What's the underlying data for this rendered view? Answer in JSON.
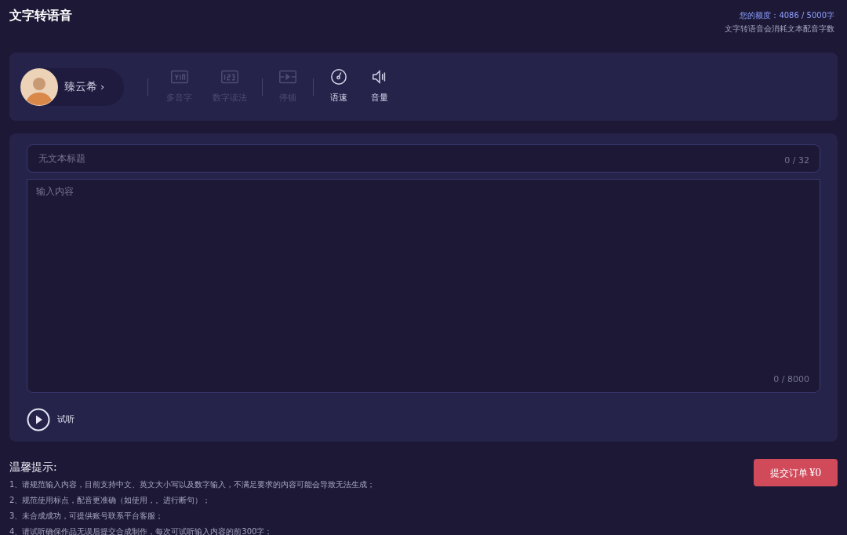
{
  "header": {
    "title": "文字转语音",
    "quota": "您的额度：4086 / 5000字",
    "quota_note": "文字转语音会消耗文本配音字数"
  },
  "voice": {
    "name": "臻云希",
    "arrow": "›"
  },
  "tools": [
    {
      "kind": "yin",
      "label": "多音字",
      "disabled": true,
      "separator_after": false
    },
    {
      "kind": "digits",
      "label": "数字读法",
      "disabled": true,
      "separator_after": true
    },
    {
      "kind": "pause",
      "label": "停顿",
      "disabled": true,
      "separator_after": true
    },
    {
      "kind": "speed",
      "label": "语速",
      "disabled": false,
      "separator_after": false
    },
    {
      "kind": "volume",
      "label": "音量",
      "disabled": false,
      "separator_after": false
    }
  ],
  "title_field": {
    "placeholder": "无文本标题",
    "counter": "0 / 32"
  },
  "content_field": {
    "placeholder": "输入内容",
    "counter": "0 / 8000"
  },
  "preview": {
    "label": "试听"
  },
  "tips": {
    "title": "温馨提示:",
    "items": [
      "1、请规范输入内容，目前支持中文、英文大小写以及数字输入，不满足要求的内容可能会导致无法生成；",
      "2、规范使用标点，配音更准确（如使用，。进行断句）；",
      "3、未合成成功，可提供账号联系平台客服；",
      "4、请试听确保作品无误后提交合成制作，每次可试听输入内容的前300字；"
    ]
  },
  "submit": {
    "label": "提交订单",
    "price": "¥0"
  }
}
